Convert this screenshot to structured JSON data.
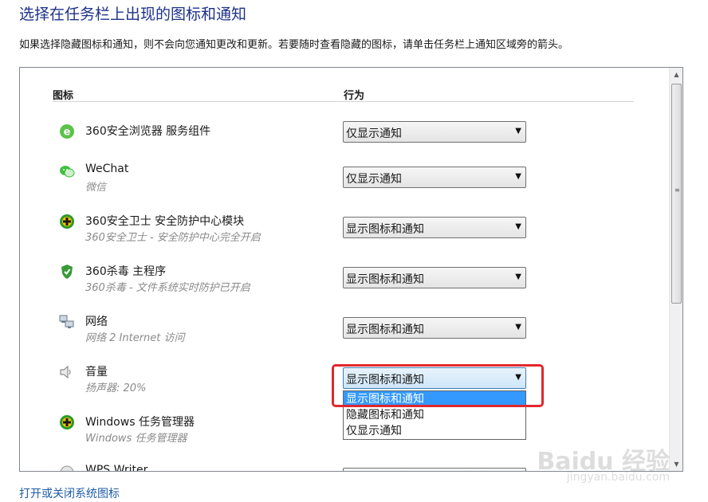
{
  "heading": "选择在任务栏上出现的图标和通知",
  "description": "如果选择隐藏图标和通知，则不会向您通知更改和更新。若要随时查看隐藏的图标，请单击任务栏上通知区域旁的箭头。",
  "columns": {
    "icon": "图标",
    "behavior": "行为"
  },
  "rows": [
    {
      "name": "360安全浏览器 服务组件",
      "sub": "",
      "icon": "browser-icon",
      "behavior": "仅显示通知"
    },
    {
      "name": "WeChat",
      "sub": "微信",
      "icon": "wechat-icon",
      "behavior": "仅显示通知"
    },
    {
      "name": "360安全卫士 安全防护中心模块",
      "sub": "360安全卫士 - 安全防护中心完全开启",
      "icon": "shield-plus-icon",
      "behavior": "显示图标和通知"
    },
    {
      "name": "360杀毒 主程序",
      "sub": "360杀毒 - 文件系统实时防护已开启",
      "icon": "antivirus-icon",
      "behavior": "显示图标和通知"
    },
    {
      "name": "网络",
      "sub": "网络 2 Internet 访问",
      "icon": "network-icon",
      "behavior": "显示图标和通知"
    },
    {
      "name": "音量",
      "sub": "扬声器: 20%",
      "icon": "speaker-icon",
      "behavior": "显示图标和通知"
    },
    {
      "name": "Windows 任务管理器",
      "sub": "Windows 任务管理器",
      "icon": "task-manager-icon",
      "behavior": ""
    },
    {
      "name": "WPS Writer",
      "sub": "",
      "icon": "wps-icon",
      "behavior": ""
    }
  ],
  "dropdown_options": [
    "显示图标和通知",
    "隐藏图标和通知",
    "仅显示通知"
  ],
  "dropdown_selected": "显示图标和通知",
  "link": "打开或关闭系统图标",
  "watermark": "Baidu 经验",
  "watermark_sub": "jingyan.baidu.com",
  "colors": {
    "heading": "#1e3287",
    "link": "#1e5ba8",
    "highlight": "#3399ff",
    "annotation": "#e0282c"
  }
}
